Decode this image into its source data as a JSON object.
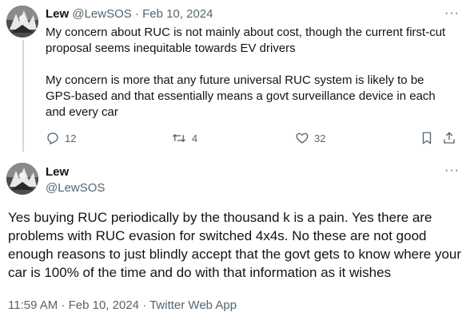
{
  "reply_parent": {
    "author_name": "Lew",
    "author_handle": "@LewSOS",
    "separator": "·",
    "date": "Feb 10, 2024",
    "paragraphs": [
      "My concern about RUC is not mainly about cost, though the current first-cut proposal seems inequitable towards EV drivers",
      "My concern is more that any future universal RUC system is likely to be GPS-based and that essentially means a govt surveillance device in each and every car"
    ],
    "stats": {
      "replies": "12",
      "reposts": "4",
      "likes": "32"
    },
    "more_label": "···"
  },
  "main_tweet": {
    "author_name": "Lew",
    "author_handle": "@LewSOS",
    "text": "Yes buying RUC periodically by the thousand k is a pain. Yes there are problems with RUC evasion for switched 4x4s. No these are not good enough reasons to just blindly accept that the govt gets to know where your car is 100% of the time and do with that information as it wishes",
    "time": "11:59 AM",
    "separator1": "·",
    "date": "Feb 10, 2024",
    "separator2": "·",
    "source": "Twitter Web App",
    "more_label": "···"
  },
  "icons": {
    "reply": "reply-icon",
    "repost": "repost-icon",
    "like": "heart-icon",
    "bookmark": "bookmark-icon",
    "share": "share-icon",
    "more": "more-icon"
  },
  "colors": {
    "text_primary": "#0f1419",
    "text_secondary": "#536471",
    "thread_line": "#cfd9de",
    "background": "#ffffff"
  }
}
